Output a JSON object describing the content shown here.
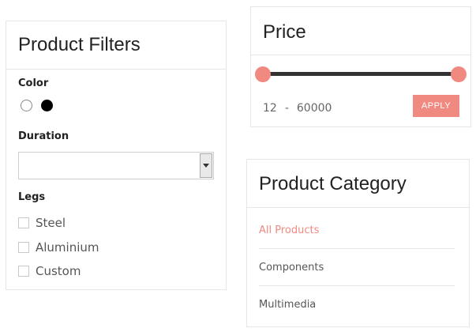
{
  "filters": {
    "title": "Product Filters",
    "color_label": "Color",
    "colors": [
      "#ffffff",
      "#000000"
    ],
    "duration_label": "Duration",
    "duration_value": "",
    "legs_label": "Legs",
    "legs_options": [
      "Steel",
      "Aluminium",
      "Custom"
    ]
  },
  "price": {
    "title": "Price",
    "min": "12",
    "separator": "-",
    "max": "60000",
    "apply_label": "APPLY",
    "accent": "#f08a80"
  },
  "category": {
    "title": "Product Category",
    "items": [
      "All Products",
      "Components",
      "Multimedia"
    ],
    "active_index": 0
  }
}
